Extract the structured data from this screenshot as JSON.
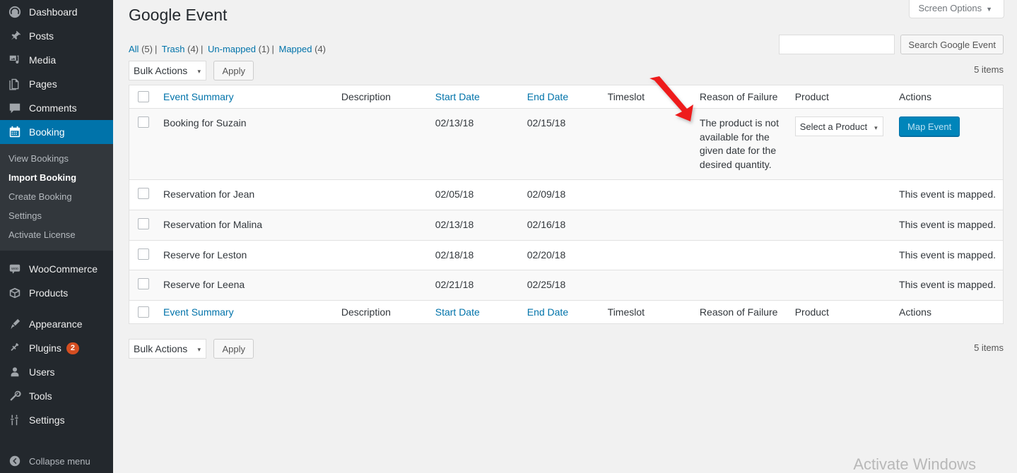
{
  "sidebar": {
    "items": [
      {
        "label": "Dashboard",
        "icon": "dashboard-icon",
        "name": "dashboard"
      },
      {
        "label": "Posts",
        "icon": "pin-icon",
        "name": "posts"
      },
      {
        "label": "Media",
        "icon": "media-icon",
        "name": "media"
      },
      {
        "label": "Pages",
        "icon": "pages-icon",
        "name": "pages"
      },
      {
        "label": "Comments",
        "icon": "comments-icon",
        "name": "comments"
      },
      {
        "label": "Booking",
        "icon": "calendar-icon",
        "name": "booking",
        "current": true
      }
    ],
    "booking_submenu": [
      {
        "label": "View Bookings",
        "name": "view-bookings"
      },
      {
        "label": "Import Booking",
        "name": "import-booking",
        "current": true
      },
      {
        "label": "Create Booking",
        "name": "create-booking"
      },
      {
        "label": "Settings",
        "name": "settings"
      },
      {
        "label": "Activate License",
        "name": "activate-license"
      }
    ],
    "items_lower": [
      {
        "label": "WooCommerce",
        "icon": "woocommerce-icon",
        "name": "woocommerce"
      },
      {
        "label": "Products",
        "icon": "products-icon",
        "name": "products"
      }
    ],
    "items_bottom": [
      {
        "label": "Appearance",
        "icon": "appearance-icon",
        "name": "appearance"
      },
      {
        "label": "Plugins",
        "icon": "plugins-icon",
        "name": "plugins",
        "badge": "2"
      },
      {
        "label": "Users",
        "icon": "users-icon",
        "name": "users"
      },
      {
        "label": "Tools",
        "icon": "tools-icon",
        "name": "tools"
      },
      {
        "label": "Settings",
        "icon": "settings-icon",
        "name": "settings"
      }
    ],
    "collapse": {
      "label": "Collapse menu",
      "icon": "collapse-arrow-icon"
    }
  },
  "screen_meta": {
    "screen_options_label": "Screen Options",
    "caret": "▼"
  },
  "header": {
    "title": "Google Event"
  },
  "filters": [
    {
      "label": "All",
      "count": "(5)"
    },
    {
      "label": "Trash",
      "count": "(4)"
    },
    {
      "label": "Un-mapped",
      "count": "(1)"
    },
    {
      "label": "Mapped",
      "count": "(4)"
    }
  ],
  "filter_separator": "|",
  "search": {
    "value": "",
    "placeholder": "",
    "button_label": "Search Google Event"
  },
  "tablenav": {
    "bulk_selected": "Bulk Actions",
    "bulk_options": [
      "Bulk Actions"
    ],
    "apply_label": "Apply",
    "items_count": "5 items",
    "caret": "▾"
  },
  "table": {
    "columns": [
      {
        "label": "Event Summary",
        "sortable": true
      },
      {
        "label": "Description",
        "sortable": false
      },
      {
        "label": "Start Date",
        "sortable": true
      },
      {
        "label": "End Date",
        "sortable": true
      },
      {
        "label": "Timeslot",
        "sortable": false
      },
      {
        "label": "Reason of Failure",
        "sortable": false
      },
      {
        "label": "Product",
        "sortable": false
      },
      {
        "label": "Actions",
        "sortable": false
      }
    ],
    "rows": [
      {
        "summary": "Booking for Suzain",
        "description": "",
        "start_date": "02/13/18",
        "end_date": "02/15/18",
        "timeslot": "",
        "reason": "The product is not available for the given date for the desired quantity.",
        "product_select": "Select a Product",
        "action_button": "Map Event",
        "mapped_message": "",
        "mapped": false
      },
      {
        "summary": "Reservation for Jean",
        "description": "",
        "start_date": "02/05/18",
        "end_date": "02/09/18",
        "timeslot": "",
        "reason": "",
        "product_select": "",
        "action_button": "",
        "mapped_message": "This event is mapped.",
        "mapped": true
      },
      {
        "summary": "Reservation for Malina",
        "description": "",
        "start_date": "02/13/18",
        "end_date": "02/16/18",
        "timeslot": "",
        "reason": "",
        "product_select": "",
        "action_button": "",
        "mapped_message": "This event is mapped.",
        "mapped": true
      },
      {
        "summary": "Reserve for Leston",
        "description": "",
        "start_date": "02/18/18",
        "end_date": "02/20/18",
        "timeslot": "",
        "reason": "",
        "product_select": "",
        "action_button": "",
        "mapped_message": "This event is mapped.",
        "mapped": true
      },
      {
        "summary": "Reserve for Leena",
        "description": "",
        "start_date": "02/21/18",
        "end_date": "02/25/18",
        "timeslot": "",
        "reason": "",
        "product_select": "",
        "action_button": "",
        "mapped_message": "This event is mapped.",
        "mapped": true
      }
    ]
  },
  "annotation": {
    "type": "red-arrow",
    "color": "#ee1d1d",
    "points_to": "Reason of Failure column"
  },
  "watermark": {
    "text": "Activate Windows"
  },
  "colors": {
    "sidebar_bg": "#23282d",
    "submenu_bg": "#32373c",
    "accent_blue": "#0073aa",
    "link_blue": "#0073aa",
    "button_blue": "#0085ba",
    "badge_orange": "#d54e21",
    "page_bg": "#f1f1f1"
  }
}
